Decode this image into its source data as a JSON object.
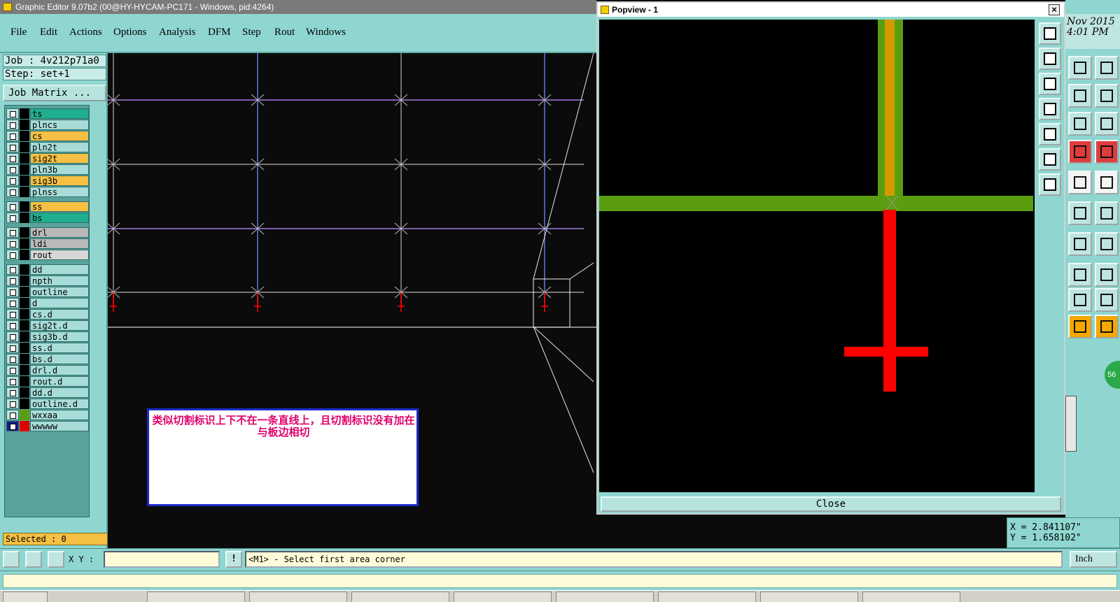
{
  "window": {
    "title": "Graphic Editor 9.07b2 (00@HY-HYCAM-PC171 - Windows, pid:4264)"
  },
  "menu": {
    "items": [
      "File",
      "Edit",
      "Actions",
      "Options",
      "Analysis",
      "DFM",
      "Step",
      "Rout",
      "Windows"
    ]
  },
  "job": {
    "job_label": "Job : 4v212p71a0",
    "step_label": "Step: set+1",
    "matrix_button": "Job Matrix ..."
  },
  "layers": [
    {
      "name": "ts",
      "color": "#1fae8e"
    },
    {
      "name": "plncs",
      "color": "#a8dcd8"
    },
    {
      "name": "cs",
      "color": "#f5c043"
    },
    {
      "name": "pln2t",
      "color": "#a8dcd8"
    },
    {
      "name": "sig2t",
      "color": "#f5c043"
    },
    {
      "name": "pln3b",
      "color": "#a8dcd8"
    },
    {
      "name": "sig3b",
      "color": "#f5c043"
    },
    {
      "name": "plnss",
      "color": "#a8dcd8"
    },
    {
      "name": "ss",
      "color": "#f5c043"
    },
    {
      "name": "bs",
      "color": "#1fae8e"
    },
    {
      "name": "drl",
      "color": "#b9b9b9"
    },
    {
      "name": "ldi",
      "color": "#b9b9b9"
    },
    {
      "name": "rout",
      "color": "#d6d6d6"
    },
    {
      "name": "dd",
      "color": "#a8dcd8"
    },
    {
      "name": "npth",
      "color": "#a8dcd8"
    },
    {
      "name": "outline",
      "color": "#a8dcd8"
    },
    {
      "name": "d",
      "color": "#a8dcd8"
    },
    {
      "name": "cs.d",
      "color": "#a8dcd8"
    },
    {
      "name": "sig2t.d",
      "color": "#a8dcd8"
    },
    {
      "name": "sig3b.d",
      "color": "#a8dcd8"
    },
    {
      "name": "ss.d",
      "color": "#a8dcd8"
    },
    {
      "name": "bs.d",
      "color": "#a8dcd8"
    },
    {
      "name": "drl.d",
      "color": "#a8dcd8"
    },
    {
      "name": "rout.d",
      "color": "#a8dcd8"
    },
    {
      "name": "dd.d",
      "color": "#a8dcd8"
    },
    {
      "name": "outline.d",
      "color": "#a8dcd8"
    },
    {
      "name": "wxxaa",
      "color": "#a8dcd8",
      "swatch": "#5a9e10"
    },
    {
      "name": "wwwww",
      "color": "#a8dcd8",
      "swatch": "#e00000",
      "active": true
    }
  ],
  "selected": "Selected : 0",
  "note": {
    "text": "类似切割标识上下不在一条直线上，且切割标识没有加在与板边相切"
  },
  "popview": {
    "title": "Popview - 1",
    "close_label": "Close"
  },
  "clock": {
    "date": "Nov 2015",
    "time": "4:01 PM"
  },
  "coords": {
    "x": "X = 2.841107\"",
    "y": "Y = 1.658102\""
  },
  "command": {
    "xy_label": "X Y :",
    "prompt": "<M1> - Select first area corner",
    "units": "Inch"
  },
  "side_badge": "56",
  "icons": {
    "app": "app-icon",
    "close": "close-icon"
  },
  "colors": {
    "panel": "#8fd6d0",
    "canvas": "#000000",
    "grid_violet": "#a07de0",
    "grid_blue": "#6a7ef0",
    "pad_green": "#5a9e10",
    "pad_orange": "#d39a00",
    "feature_red": "#ff0000",
    "note_text": "#e0006a",
    "note_border": "#1b2bc8"
  }
}
